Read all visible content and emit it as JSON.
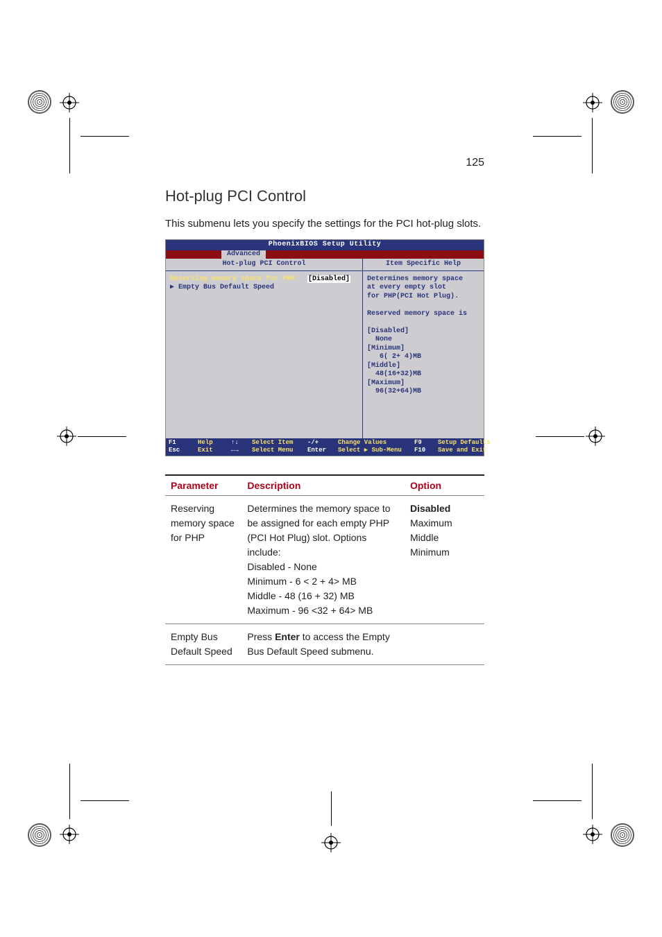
{
  "page_number": "125",
  "heading": "Hot-plug PCI Control",
  "intro": "This submenu lets you specify the settings for the PCI hot-plug  slots.",
  "bios": {
    "title": "PhoenixBIOS Setup Utility",
    "tab": "Advanced",
    "left_header": "Hot-plug PCI Control",
    "right_header": "Item Specific Help",
    "row1_label": "Reserving memory space for PHP:",
    "row1_value": "[Disabled]",
    "row2_label": "▶ Empty Bus Default Speed",
    "help_lines": "Determines memory space\nat every empty slot\nfor PHP(PCI Hot Plug).\n\nReserved memory space is\n\n[Disabled]\n  None\n[Minimum]\n   6( 2+ 4)MB\n[Middle]\n  48(16+32)MB\n[Maximum]\n  96(32+64)MB",
    "footer": {
      "f1": "F1",
      "help": "Help",
      "esc": "Esc",
      "exit": "Exit",
      "arrows_ud": "↑↓",
      "sel_item": "Select Item",
      "arrows_lr": "←→",
      "sel_menu": "Select Menu",
      "pm": "-/+",
      "chg": "Change Values",
      "enter": "Enter",
      "sub": "Select ▶ Sub-Menu",
      "f9": "F9",
      "def": "Setup Defaults",
      "f10": "F10",
      "save": "Save and Exit"
    }
  },
  "table": {
    "headers": {
      "param": "Parameter",
      "desc": "Description",
      "opt": "Option"
    },
    "rows": [
      {
        "param": "Reserving memory space for PHP",
        "desc": "Determines the memory space to be assigned for each empty PHP (PCI Hot Plug) slot. Options include:\nDisabled - None\nMinimum - 6 < 2 + 4> MB\nMiddle - 48 (16 + 32) MB\nMaximum -  96 <32 + 64> MB",
        "opt_bold": "Disabled",
        "opt_rest": "Maximum\nMiddle\nMinimum"
      },
      {
        "param": "Empty Bus Default Speed",
        "desc_pre": "Press ",
        "desc_bold": "Enter",
        "desc_post": " to access the Empty Bus Default Speed submenu.",
        "opt_bold": "",
        "opt_rest": ""
      }
    ]
  }
}
